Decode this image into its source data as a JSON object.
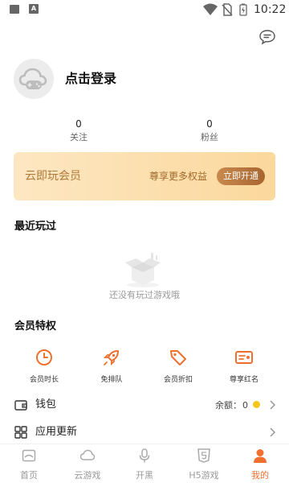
{
  "status_bar": {
    "time": "10:22",
    "icons": [
      "image-icon",
      "font-icon",
      "wifi-icon",
      "no-sim-icon",
      "battery-icon"
    ]
  },
  "header": {
    "message_icon": "chat-bubble-icon"
  },
  "profile": {
    "login_text": "点击登录",
    "stats": [
      {
        "value": "0",
        "label": "关注"
      },
      {
        "value": "0",
        "label": "粉丝"
      }
    ]
  },
  "vip_banner": {
    "title": "云即玩会员",
    "description": "尊享更多权益",
    "button": "立即开通",
    "colors": {
      "start": "#fde7c2",
      "end": "#fbd89c",
      "button": "#b5723a"
    }
  },
  "recent": {
    "title": "最近玩过",
    "empty_text": "还没有玩过游戏哦"
  },
  "perks": {
    "title": "会员特权",
    "items": [
      {
        "label": "会员时长",
        "icon": "clock-icon"
      },
      {
        "label": "免排队",
        "icon": "rocket-icon"
      },
      {
        "label": "会员折扣",
        "icon": "price-tag-icon"
      },
      {
        "label": "尊享红名",
        "icon": "id-card-icon"
      }
    ],
    "accent": "#f07030"
  },
  "menu": {
    "wallet": {
      "label": "钱包",
      "balance_label": "余额：",
      "balance_value": "0"
    },
    "update": {
      "label": "应用更新"
    }
  },
  "bottom_nav": {
    "items": [
      {
        "label": "首页",
        "icon": "home-icon",
        "active": false
      },
      {
        "label": "云游戏",
        "icon": "cloud-icon",
        "active": false
      },
      {
        "label": "开黑",
        "icon": "microphone-icon",
        "active": false
      },
      {
        "label": "H5游戏",
        "icon": "h5-icon",
        "active": false
      },
      {
        "label": "我的",
        "icon": "user-icon",
        "active": true
      }
    ],
    "active_color": "#f07030",
    "inactive_color": "#999999"
  }
}
